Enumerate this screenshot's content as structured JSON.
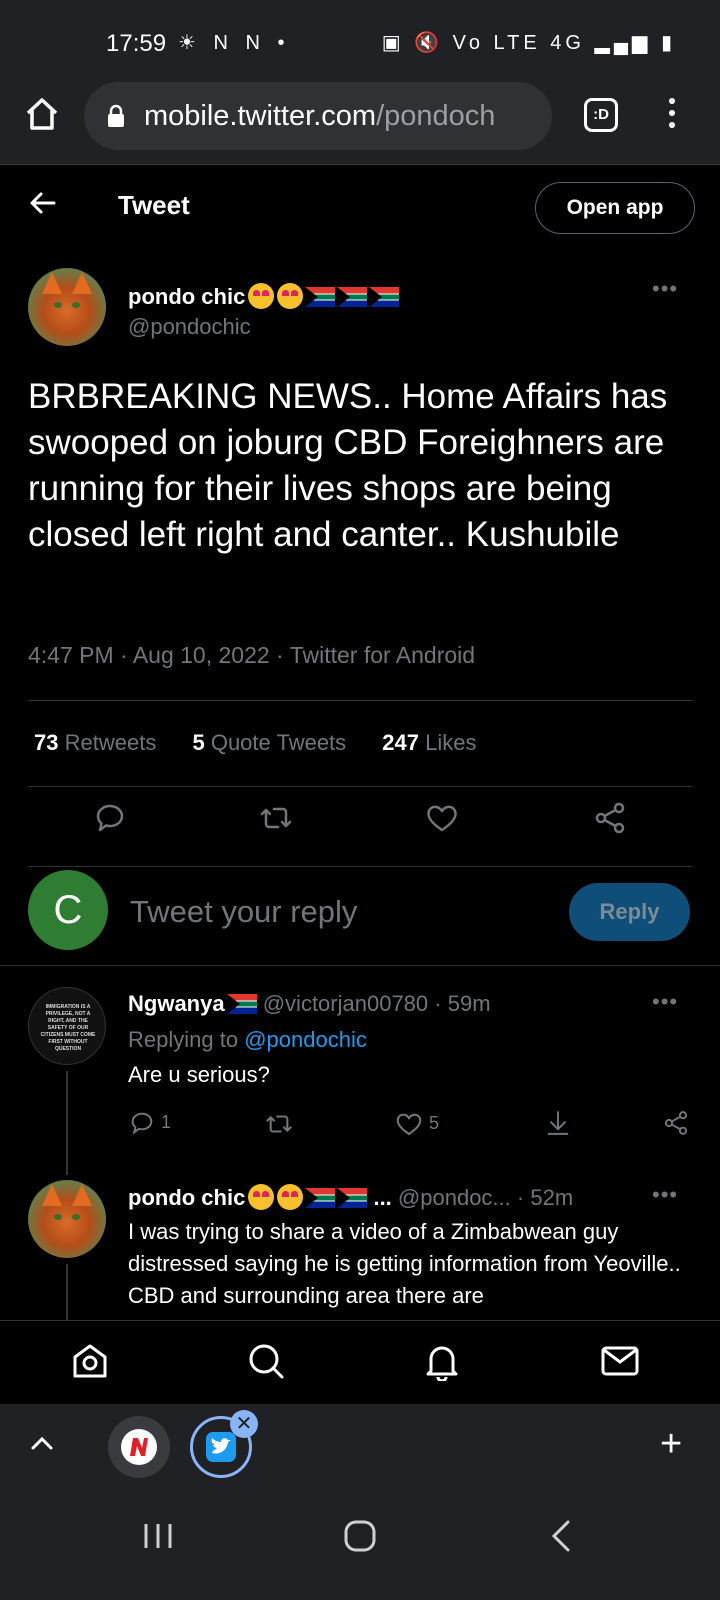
{
  "statusbar": {
    "time": "17:59",
    "left_icons": "☀ N N •",
    "right_icons": "▣ 🔇 Vo LTE 4G ▂▄▆ ▮"
  },
  "browser": {
    "url_host": "mobile.twitter.com",
    "url_path": "/pondoch",
    "tabs_label": ":D"
  },
  "topnav": {
    "title": "Tweet",
    "open_app_label": "Open app"
  },
  "tweet": {
    "author_name": "pondo chic",
    "author_handle": "@pondochic",
    "text": "BRBREAKING NEWS.. Home Affairs has swooped on joburg CBD Foreighners are running for their lives shops are being closed left right and canter.. Kushubile",
    "meta": "4:47 PM · Aug 10, 2022 · Twitter for Android",
    "stats": {
      "retweets_count": "73",
      "retweets_label": "Retweets",
      "quotes_count": "5",
      "quotes_label": "Quote Tweets",
      "likes_count": "247",
      "likes_label": "Likes"
    }
  },
  "reply_box": {
    "avatar_letter": "C",
    "placeholder": "Tweet your reply",
    "button_label": "Reply"
  },
  "replies": [
    {
      "name": "Ngwanya",
      "handle": "@victorjan00780",
      "time": "· 59m",
      "replying_to_label": "Replying to",
      "replying_to_handle": "@pondochic",
      "text": "Are u serious?",
      "reply_count": "1",
      "like_count": "5",
      "avatar_text": "IMMIGRATION IS A PRIVILEGE, NOT A RIGHT, AND THE SAFETY OF OUR CITIZENS MUST COME FIRST WITHOUT QUESTION"
    },
    {
      "name": "pondo chic",
      "ellipsis": "...",
      "handle": "@pondoc...",
      "time": "· 52m",
      "text": "I was trying to share a video of a Zimbabwean guy distressed saying he is getting information from Yeoville.. CBD and surrounding area there are"
    }
  ],
  "chrome_tabs": {
    "close_glyph": "✕",
    "plus_glyph": "+"
  },
  "colors": {
    "accent": "#1d9bf0",
    "reply_button": "#0f4e78",
    "avatar_c": "#2e7d32"
  }
}
